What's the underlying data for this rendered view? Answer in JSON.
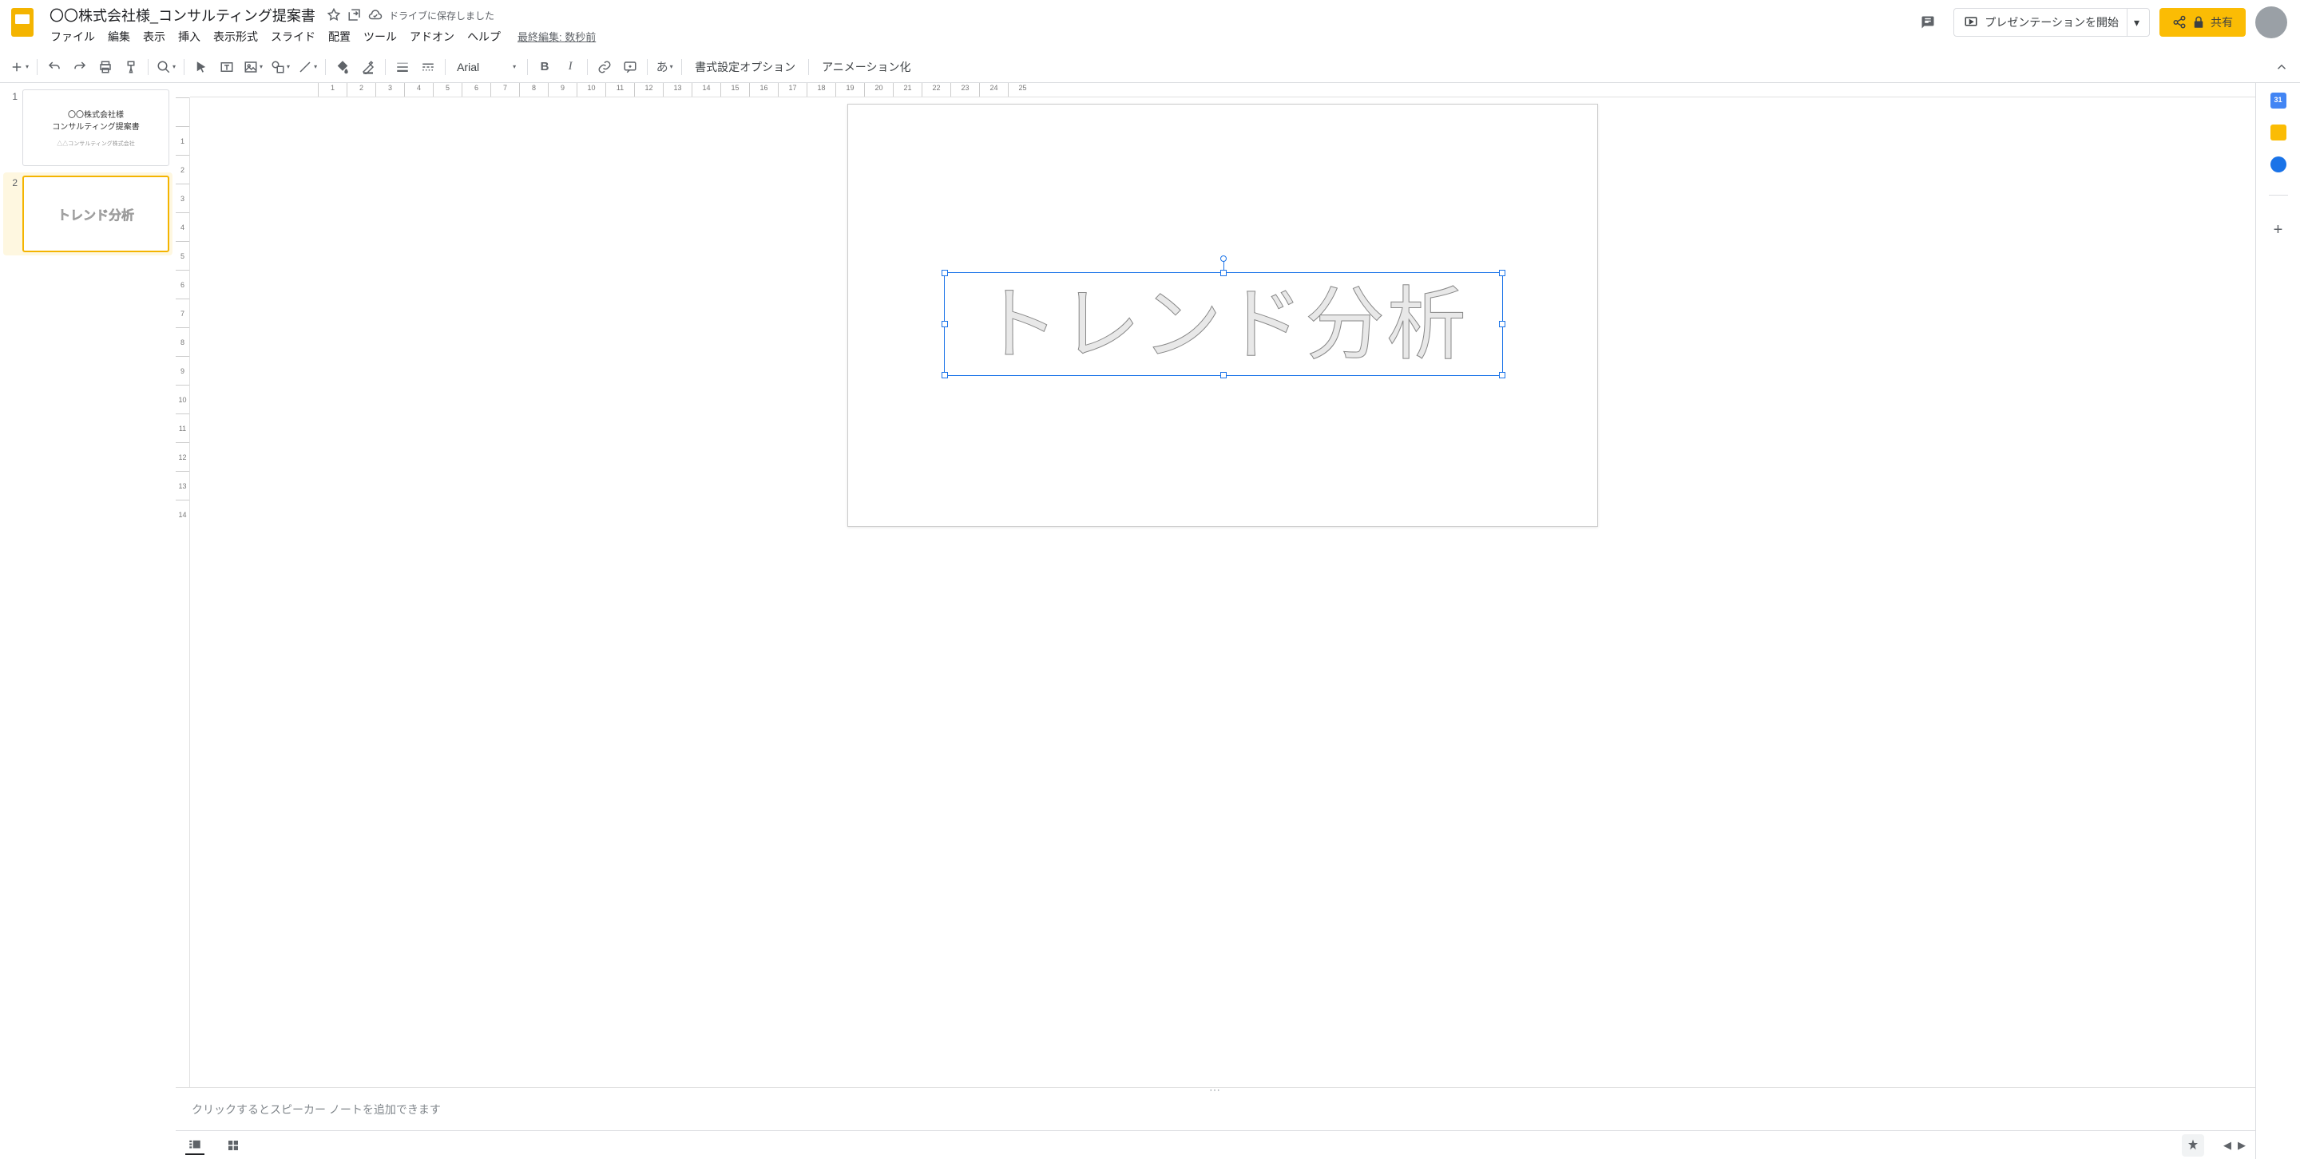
{
  "header": {
    "title": "〇〇株式会社様_コンサルティング提案書",
    "save_status": "ドライブに保存しました",
    "last_edit": "最終編集: 数秒前",
    "present_label": "プレゼンテーションを開始",
    "share_label": "共有"
  },
  "menu": {
    "file": "ファイル",
    "edit": "編集",
    "view": "表示",
    "insert": "挿入",
    "format": "表示形式",
    "slide": "スライド",
    "arrange": "配置",
    "tools": "ツール",
    "addons": "アドオン",
    "help": "ヘルプ"
  },
  "toolbar": {
    "font": "Arial",
    "format_options": "書式設定オプション",
    "animate": "アニメーション化",
    "input_tool": "あ"
  },
  "thumbnails": [
    {
      "num": "1",
      "line1": "〇〇株式会社様",
      "line2": "コンサルティング提案書",
      "subtitle": "△△コンサルティング株式会社"
    },
    {
      "num": "2",
      "wordart": "トレンド分析"
    }
  ],
  "canvas": {
    "wordart_text": "トレンド分析",
    "ruler_h": [
      "1",
      "2",
      "3",
      "4",
      "5",
      "6",
      "7",
      "8",
      "9",
      "10",
      "11",
      "12",
      "13",
      "14",
      "15",
      "16",
      "17",
      "18",
      "19",
      "20",
      "21",
      "22",
      "23",
      "24",
      "25"
    ],
    "ruler_v": [
      "",
      "1",
      "2",
      "3",
      "4",
      "5",
      "6",
      "7",
      "8",
      "9",
      "10",
      "11",
      "12",
      "13",
      "14"
    ]
  },
  "notes": {
    "placeholder": "クリックするとスピーカー ノートを追加できます"
  }
}
